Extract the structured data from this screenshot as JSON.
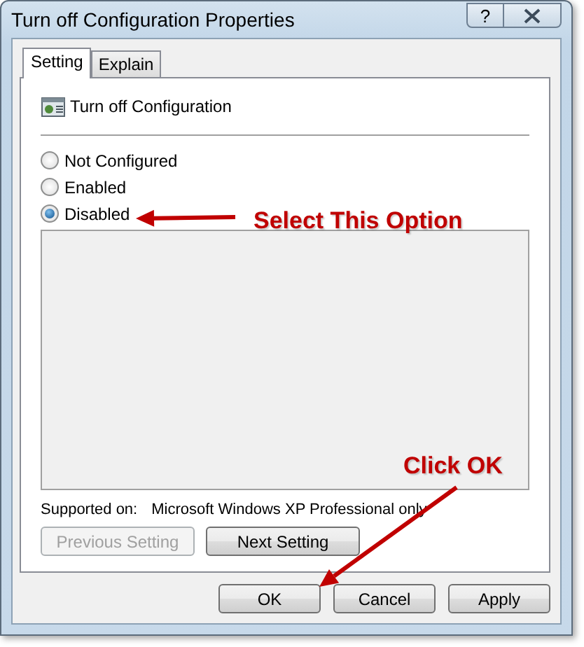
{
  "window": {
    "title": "Turn off Configuration Properties",
    "help_button": "?"
  },
  "tabs": [
    {
      "label": "Setting",
      "selected": true
    },
    {
      "label": "Explain",
      "selected": false
    }
  ],
  "setting_title": "Turn off Configuration",
  "options": [
    {
      "label": "Not Configured",
      "selected": false
    },
    {
      "label": "Enabled",
      "selected": false
    },
    {
      "label": "Disabled",
      "selected": true
    }
  ],
  "supported_label": "Supported on:",
  "supported_value": "Microsoft Windows XP Professional only",
  "nav_buttons": [
    {
      "label": "Previous Setting",
      "disabled": true
    },
    {
      "label": "Next Setting",
      "disabled": false
    }
  ],
  "buttons": [
    "OK",
    "Cancel",
    "Apply"
  ],
  "annotations": [
    {
      "text": "Select This Option"
    },
    {
      "text": "Click OK"
    }
  ]
}
